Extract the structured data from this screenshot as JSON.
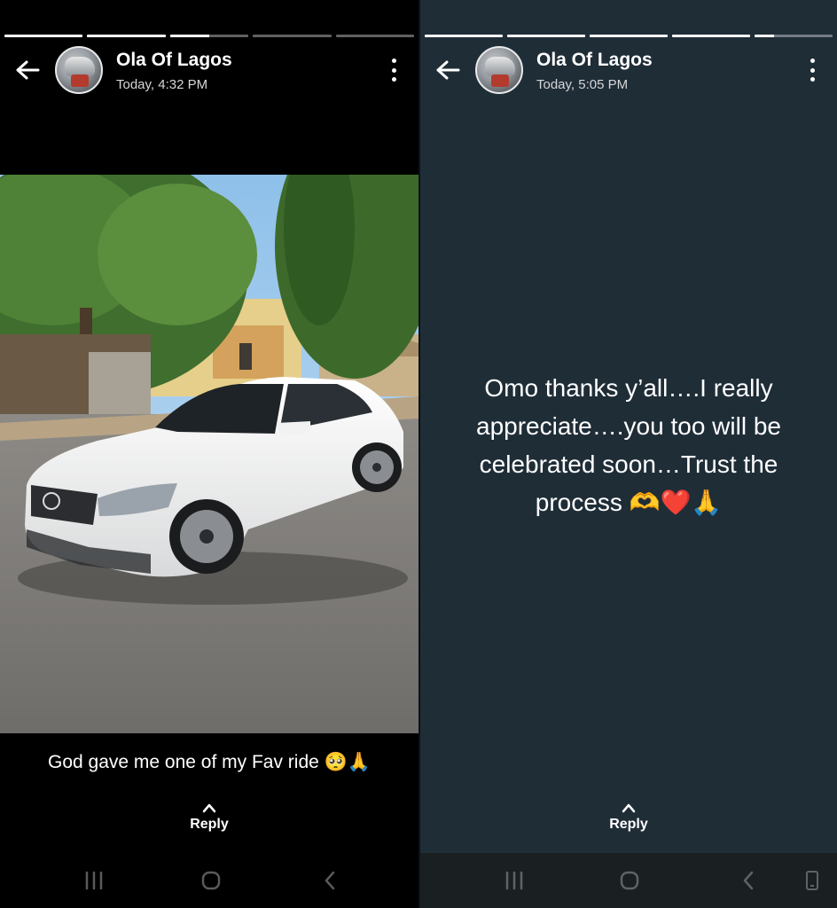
{
  "left_story": {
    "contact_name": "Ola Of Lagos",
    "timestamp": "Today, 4:32 PM",
    "progress": [
      1,
      1,
      0.5,
      0,
      0
    ],
    "caption": "God gave me one of my Fav ride 🥺🙏",
    "reply_label": "Reply"
  },
  "right_story": {
    "contact_name": "Ola Of Lagos",
    "timestamp": "Today, 5:05 PM",
    "progress": [
      1,
      1,
      1,
      1,
      0.25
    ],
    "status_text": "Omo thanks y’all….I really appreciate….you too will be celebrated soon…Trust the process 🫶❤️🙏",
    "background_color": "#1f2d37",
    "reply_label": "Reply"
  },
  "icons": {
    "back": "arrow-left-icon",
    "menu": "more-vertical-icon",
    "reply": "chevron-up-icon",
    "nav_recents": "recents-icon",
    "nav_home": "home-icon",
    "nav_back": "nav-back-icon",
    "nav_rotate": "rotate-icon"
  }
}
